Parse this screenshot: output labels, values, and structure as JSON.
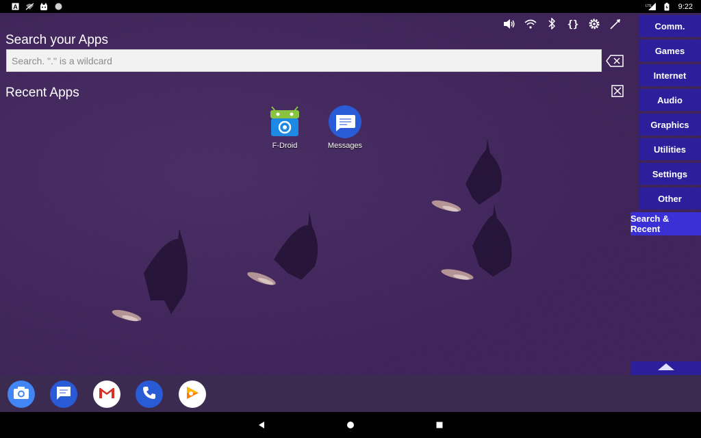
{
  "status_bar": {
    "time": "9:22",
    "left_icons": [
      "a-notification-icon",
      "wifi-off-icon",
      "cat-notification-icon",
      "circle-notification-icon"
    ],
    "right_icons": [
      "lte-signal-icon",
      "battery-icon"
    ],
    "network_label": "LTE"
  },
  "quick_toggles": [
    "volume-icon",
    "wifi-icon",
    "bluetooth-icon",
    "braces-icon",
    "settings-gear-icon",
    "wrench-icon"
  ],
  "search": {
    "heading": "Search your Apps",
    "placeholder": "Search. \".\" is a wildcard",
    "value": ""
  },
  "recent": {
    "heading": "Recent Apps",
    "apps": [
      {
        "label": "F-Droid",
        "icon": "fdroid-icon"
      },
      {
        "label": "Messages",
        "icon": "messages-icon"
      }
    ]
  },
  "categories": [
    {
      "label": "Comm."
    },
    {
      "label": "Games"
    },
    {
      "label": "Internet"
    },
    {
      "label": "Audio"
    },
    {
      "label": "Graphics"
    },
    {
      "label": "Utilities"
    },
    {
      "label": "Settings"
    },
    {
      "label": "Other"
    },
    {
      "label": "Search & Recent",
      "active": true
    }
  ],
  "dock": [
    {
      "name": "camera",
      "icon": "camera-icon"
    },
    {
      "name": "messages",
      "icon": "messages-icon"
    },
    {
      "name": "gmail",
      "icon": "gmail-icon"
    },
    {
      "name": "phone",
      "icon": "phone-icon"
    },
    {
      "name": "play-music",
      "icon": "play-music-icon"
    }
  ],
  "nav_bar": [
    "back-icon",
    "home-icon",
    "recents-icon"
  ],
  "colors": {
    "category_bg": "#2b1f9b",
    "category_active_bg": "#3b2fd6",
    "wallpaper": "#3a1f55"
  }
}
